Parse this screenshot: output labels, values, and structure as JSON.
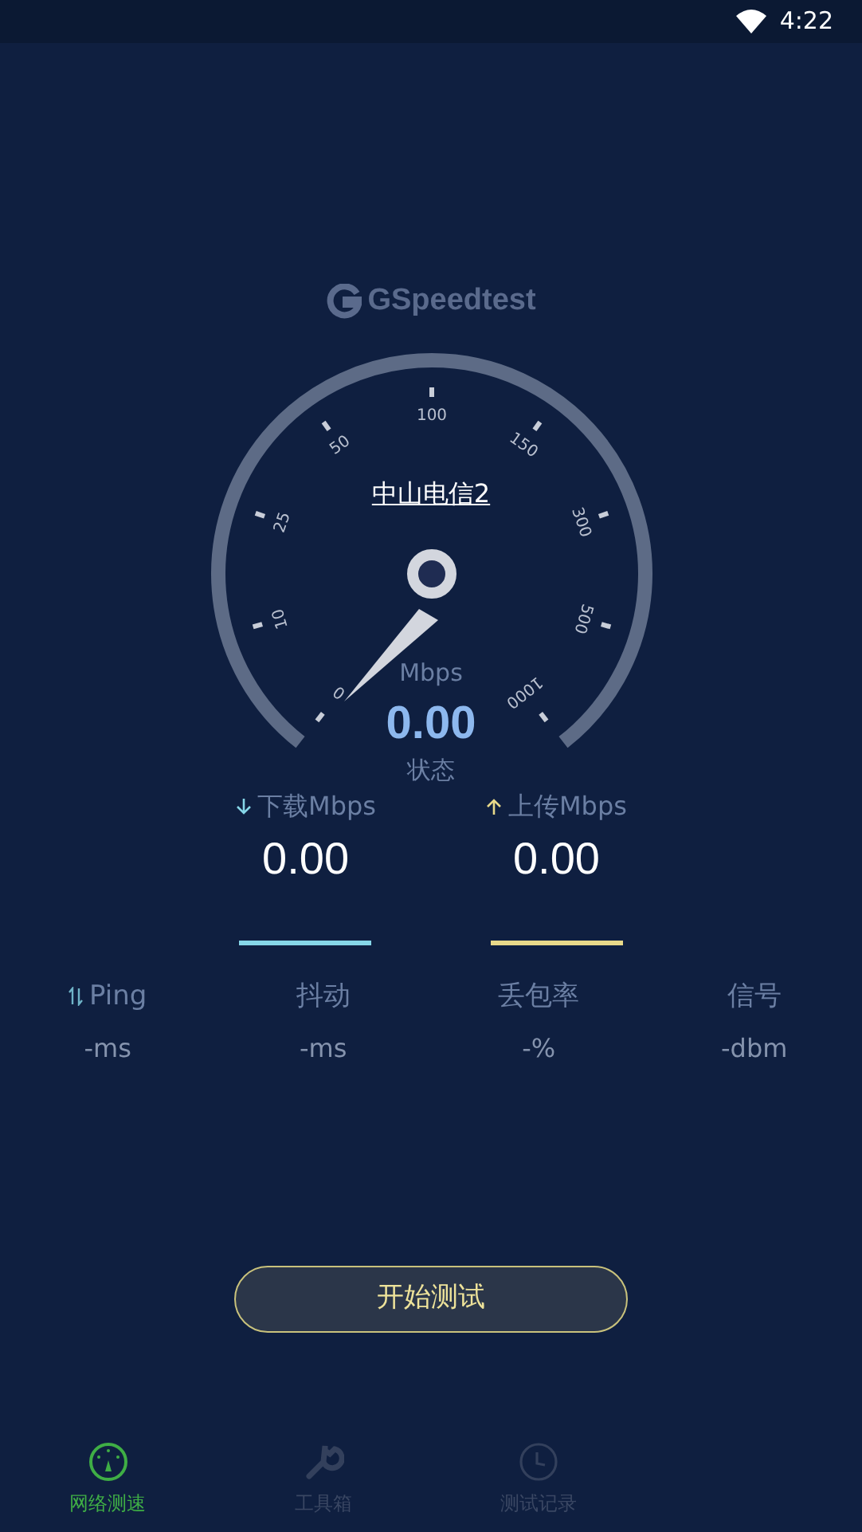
{
  "status_bar": {
    "time": "4:22"
  },
  "logo": {
    "text": "GSpeedtest"
  },
  "gauge": {
    "server": "中山电信2",
    "scale": [
      "0",
      "10",
      "25",
      "50",
      "100",
      "150",
      "300",
      "500",
      "1000"
    ],
    "unit": "Mbps",
    "speed": "0.00",
    "status": "状态"
  },
  "transfer": [
    {
      "kind": "download",
      "label": "下载Mbps",
      "value": "0.00",
      "color": "#86d6e8"
    },
    {
      "kind": "upload",
      "label": "上传Mbps",
      "value": "0.00",
      "color": "#e8d98a"
    }
  ],
  "metrics": [
    {
      "kind": "ping",
      "label": "Ping",
      "value": "-ms"
    },
    {
      "kind": "plain",
      "label": "抖动",
      "value": "-ms"
    },
    {
      "kind": "plain",
      "label": "丢包率",
      "value": "-%"
    },
    {
      "kind": "plain",
      "label": "信号",
      "value": "-dbm"
    }
  ],
  "start_button": "开始测试",
  "nav": [
    {
      "kind": "gauge",
      "label": "网络测速",
      "selected": true
    },
    {
      "kind": "wrench",
      "label": "工具箱",
      "selected": false
    },
    {
      "kind": "clock",
      "label": "测试记录",
      "selected": false
    }
  ]
}
